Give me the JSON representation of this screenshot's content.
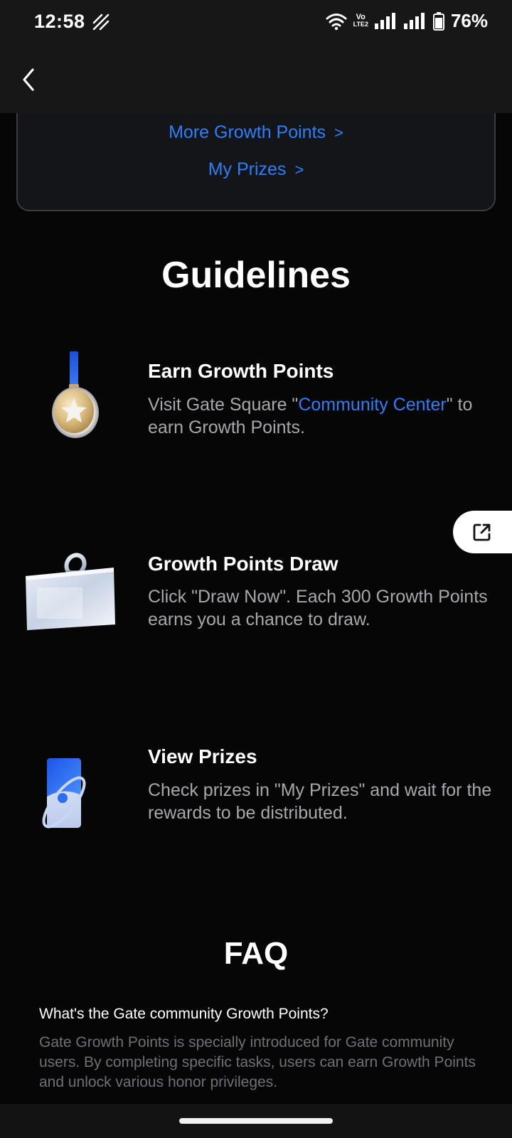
{
  "status": {
    "time": "12:58",
    "battery": "76%",
    "volte": "Vo",
    "lte": "LTE2"
  },
  "card": {
    "more_points": "More Growth Points",
    "my_prizes": "My Prizes",
    "chevron": ">"
  },
  "guidelines": {
    "title": "Guidelines",
    "items": [
      {
        "title": "Earn Growth Points",
        "desc_before": "Visit Gate Square \"",
        "desc_link": "Community Center",
        "desc_after": "\" to earn Growth Points.",
        "icon": "medal-icon"
      },
      {
        "title": "Growth Points Draw",
        "desc": "Click \"Draw Now\". Each 300 Growth Points earns you a chance to draw.",
        "icon": "draw-box-icon"
      },
      {
        "title": "View Prizes",
        "desc": "Check prizes in \"My Prizes\" and wait for the rewards to be distributed.",
        "icon": "prize-card-icon"
      }
    ]
  },
  "faq": {
    "title": "FAQ",
    "question": "What's the Gate community Growth Points?",
    "answer": "Gate Growth Points is specially introduced for Gate community users. By completing specific tasks, users can earn Growth Points and unlock various honor privileges."
  },
  "colors": {
    "accent": "#2d7ff9",
    "background": "#060606",
    "header": "#171717"
  }
}
